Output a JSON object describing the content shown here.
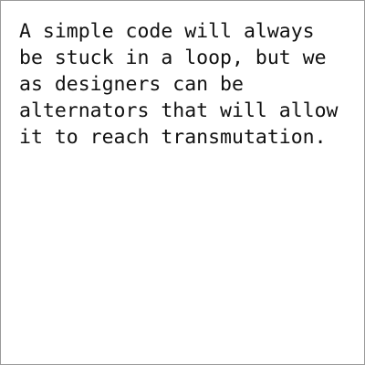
{
  "document": {
    "lines": [
      "A simple code will always",
      "be stuck in a loop, but we",
      "as designers can be",
      "alternators that will allow",
      "it to reach transmutation."
    ]
  }
}
